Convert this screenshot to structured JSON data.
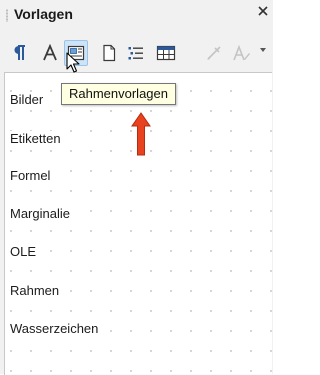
{
  "panel": {
    "title": "Vorlagen",
    "close_glyph": "▾"
  },
  "toolbar": {
    "buttons": [
      {
        "icon": "paragraph-styles-icon",
        "label": "Absatzvorlagen"
      },
      {
        "icon": "character-styles-icon",
        "label": "Zeichenvorlagen"
      },
      {
        "icon": "frame-styles-icon",
        "label": "Rahmenvorlagen",
        "active": true
      },
      {
        "icon": "page-styles-icon",
        "label": "Seitenvorlagen"
      },
      {
        "icon": "list-styles-icon",
        "label": "Listenvorlagen"
      },
      {
        "icon": "table-styles-icon",
        "label": "Tabellenvorlagen"
      },
      {
        "icon": "fill-format-icon",
        "label": "Gießkannenmodus"
      },
      {
        "icon": "new-style-icon",
        "label": "Vorlagenaktionen"
      }
    ]
  },
  "tooltip": {
    "text": "Rahmenvorlagen"
  },
  "styles_list": [
    "Bilder",
    "Etiketten",
    "Formel",
    "Marginalie",
    "OLE",
    "Rahmen",
    "Wasserzeichen"
  ],
  "colors": {
    "accent_active": "#cde3f7",
    "annotation_arrow": "#e8421e",
    "tooltip_bg": "#ffffe1"
  }
}
